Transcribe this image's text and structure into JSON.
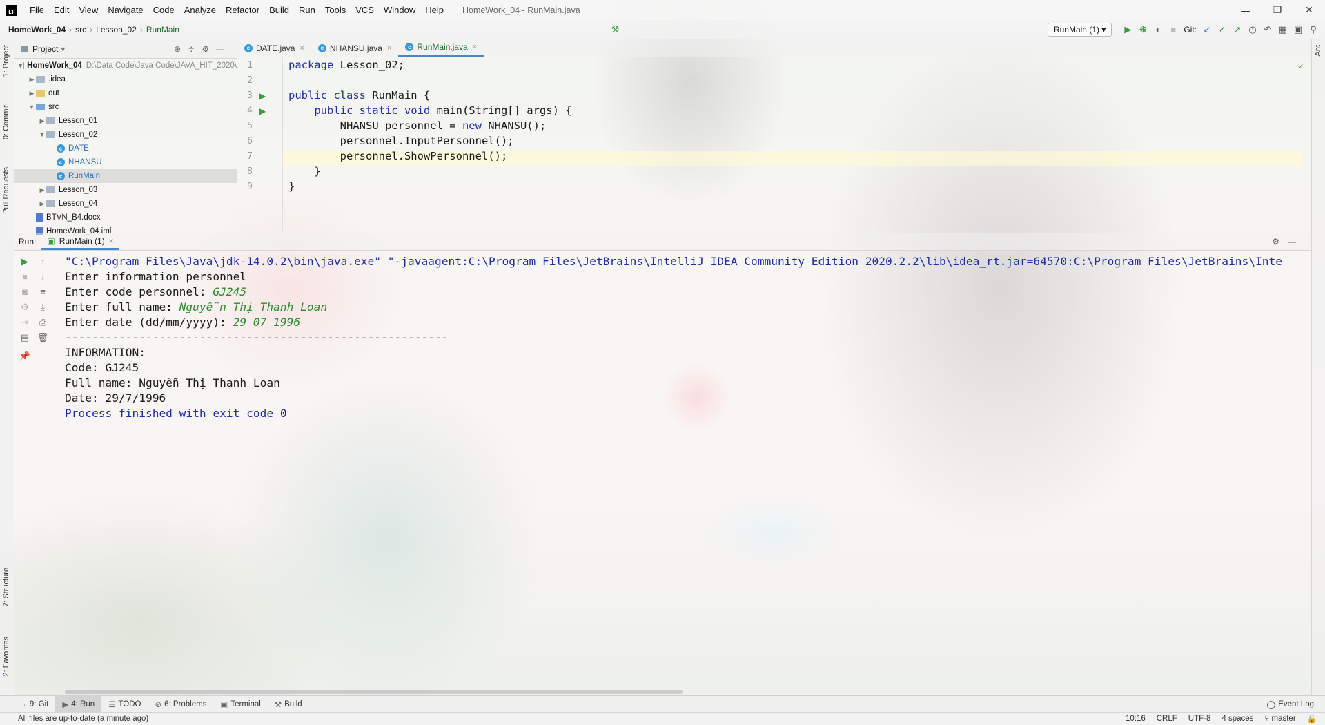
{
  "app": {
    "window_title": "HomeWork_04 - RunMain.java"
  },
  "menu": [
    "File",
    "Edit",
    "View",
    "Navigate",
    "Code",
    "Analyze",
    "Refactor",
    "Build",
    "Run",
    "Tools",
    "VCS",
    "Window",
    "Help"
  ],
  "navbar": {
    "crumbs": [
      "HomeWork_04",
      "src",
      "Lesson_02",
      "RunMain"
    ],
    "run_config": "RunMain (1)",
    "git_label": "Git:"
  },
  "side_tabs": {
    "left": [
      "1: Project",
      "0: Commit",
      "Pull Requests",
      "7: Structure",
      "2: Favorites"
    ],
    "right": [
      "Ant"
    ]
  },
  "project": {
    "header": "Project",
    "tree": [
      {
        "label": "HomeWork_04",
        "path": "D:\\Data Code\\Java Code\\JAVA_HIT_2020\\",
        "depth": 0,
        "expanded": true,
        "kind": "module"
      },
      {
        "label": ".idea",
        "depth": 1,
        "expanded": false,
        "kind": "folder"
      },
      {
        "label": "out",
        "depth": 1,
        "expanded": false,
        "kind": "folder-excluded"
      },
      {
        "label": "src",
        "depth": 1,
        "expanded": true,
        "kind": "folder-src"
      },
      {
        "label": "Lesson_01",
        "depth": 2,
        "expanded": false,
        "kind": "package"
      },
      {
        "label": "Lesson_02",
        "depth": 2,
        "expanded": true,
        "kind": "package"
      },
      {
        "label": "DATE",
        "depth": 3,
        "kind": "class"
      },
      {
        "label": "NHANSU",
        "depth": 3,
        "kind": "class"
      },
      {
        "label": "RunMain",
        "depth": 3,
        "kind": "class",
        "selected": true
      },
      {
        "label": "Lesson_03",
        "depth": 2,
        "expanded": false,
        "kind": "package"
      },
      {
        "label": "Lesson_04",
        "depth": 2,
        "expanded": false,
        "kind": "package"
      },
      {
        "label": "BTVN_B4.docx",
        "depth": 1,
        "kind": "doc"
      },
      {
        "label": "HomeWork_04.iml",
        "depth": 1,
        "kind": "file"
      }
    ]
  },
  "editor": {
    "tabs": [
      {
        "label": "DATE.java",
        "active": false
      },
      {
        "label": "NHANSU.java",
        "active": false
      },
      {
        "label": "RunMain.java",
        "active": true
      }
    ],
    "lines": [
      {
        "n": "1",
        "segments": [
          {
            "t": "package",
            "kw": true
          },
          {
            "t": " Lesson_02;"
          }
        ]
      },
      {
        "n": "2",
        "segments": []
      },
      {
        "n": "3",
        "segments": [
          {
            "t": "public class",
            "kw": true
          },
          {
            "t": " RunMain {"
          }
        ]
      },
      {
        "n": "4",
        "segments": [
          {
            "t": "    "
          },
          {
            "t": "public static void",
            "kw": true
          },
          {
            "t": " main(String[] args) {"
          }
        ]
      },
      {
        "n": "5",
        "segments": [
          {
            "t": "        NHANSU personnel = "
          },
          {
            "t": "new",
            "kw": true
          },
          {
            "t": " NHANSU();"
          }
        ]
      },
      {
        "n": "6",
        "segments": [
          {
            "t": "        personnel.InputPersonnel();"
          }
        ]
      },
      {
        "n": "7",
        "segments": [
          {
            "t": "        personnel.ShowPersonnel();"
          }
        ]
      },
      {
        "n": "8",
        "segments": [
          {
            "t": "    }"
          }
        ]
      },
      {
        "n": "9",
        "segments": [
          {
            "t": "}"
          }
        ]
      }
    ]
  },
  "run_panel": {
    "label": "Run:",
    "tab": "RunMain (1)",
    "console": [
      {
        "parts": [
          {
            "t": "\"C:\\Program Files\\Java\\jdk-14.0.2\\bin\\java.exe\" \"-javaagent:C:\\Program Files\\JetBrains\\IntelliJ IDEA Community Edition 2020.2.2\\lib\\idea_rt.jar=64570:C:\\Program Files\\JetBrains\\Inte",
            "c": "blue"
          }
        ]
      },
      {
        "parts": [
          {
            "t": "Enter information personnel"
          }
        ]
      },
      {
        "parts": [
          {
            "t": "Enter code personnel: "
          },
          {
            "t": "GJ245",
            "c": "green"
          }
        ]
      },
      {
        "parts": [
          {
            "t": "Enter full name: "
          },
          {
            "t": "Nguyễn Thị Thanh Loan",
            "c": "green"
          }
        ]
      },
      {
        "parts": [
          {
            "t": "Enter date (dd/mm/yyyy): "
          },
          {
            "t": "29 07 1996",
            "c": "green"
          }
        ]
      },
      {
        "parts": [
          {
            "t": "---------------------------------------------------------"
          }
        ]
      },
      {
        "parts": [
          {
            "t": "INFORMATION:"
          }
        ]
      },
      {
        "parts": [
          {
            "t": "Code: GJ245"
          }
        ]
      },
      {
        "parts": [
          {
            "t": "Full name: Nguyễn Thị Thanh Loan"
          }
        ]
      },
      {
        "parts": [
          {
            "t": "Date: 29/7/1996"
          }
        ]
      },
      {
        "parts": [
          {
            "t": "Process finished with exit code 0",
            "c": "blue"
          }
        ]
      }
    ]
  },
  "tool_windows": [
    {
      "label": "9: Git",
      "icon": "git-icon"
    },
    {
      "label": "4: Run",
      "icon": "run-icon",
      "active": true
    },
    {
      "label": "TODO",
      "icon": "todo-icon"
    },
    {
      "label": "6: Problems",
      "icon": "problems-icon"
    },
    {
      "label": "Terminal",
      "icon": "terminal-icon"
    },
    {
      "label": "Build",
      "icon": "build-icon"
    }
  ],
  "event_log": "Event Log",
  "status": {
    "message": "All files are up-to-date (a minute ago)",
    "position": "10:16",
    "line_sep": "CRLF",
    "encoding": "UTF-8",
    "indent": "4 spaces",
    "branch": "master"
  },
  "colors": {
    "keyword": "#1e2da8",
    "input": "#2e8b2e",
    "accent": "#4a88c7"
  }
}
